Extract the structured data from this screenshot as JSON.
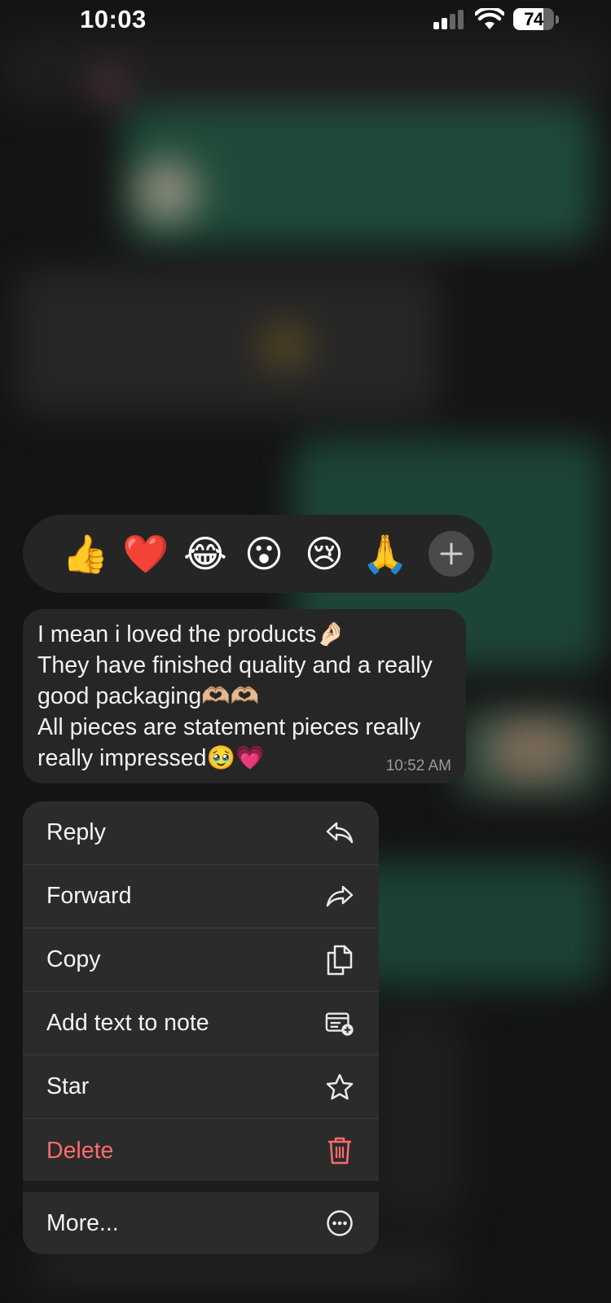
{
  "status_bar": {
    "time": "10:03",
    "battery": "74",
    "battery_level": 0.74,
    "icons": [
      "signal-icon",
      "wifi-icon",
      "battery-icon"
    ]
  },
  "reactions": {
    "items": [
      {
        "emoji": "👍",
        "name": "thumbs-up"
      },
      {
        "emoji": "❤️",
        "name": "red-heart"
      },
      {
        "emoji": "😂",
        "name": "tears-of-joy"
      },
      {
        "emoji": "😮",
        "name": "open-mouth"
      },
      {
        "emoji": "😢",
        "name": "crying-face"
      },
      {
        "emoji": "🙏",
        "name": "folded-hands"
      },
      {
        "emoji": "👌",
        "name": "ok-hand"
      }
    ],
    "more_icon": "plus-icon"
  },
  "message": {
    "text": "I mean i loved the products🤌🏻\nThey have finished quality and a really good packaging🫶🏼🫶🏼\nAll pieces are statement pieces really really impressed🥹💗",
    "time": "10:52 AM"
  },
  "menu": {
    "items": [
      {
        "label": "Reply",
        "icon": "reply-icon"
      },
      {
        "label": "Forward",
        "icon": "forward-icon"
      },
      {
        "label": "Copy",
        "icon": "copy-icon"
      },
      {
        "label": "Add text to note",
        "icon": "add-note-icon"
      },
      {
        "label": "Star",
        "icon": "star-icon"
      },
      {
        "label": "Delete",
        "icon": "trash-icon",
        "destructive": true
      }
    ],
    "more": {
      "label": "More...",
      "icon": "more-icon"
    }
  },
  "colors": {
    "background": "#141414",
    "surface": "#2b2b2b",
    "bubble": "#262626",
    "destructive": "#ff6b6b",
    "chat_green": "#1f4a39"
  }
}
